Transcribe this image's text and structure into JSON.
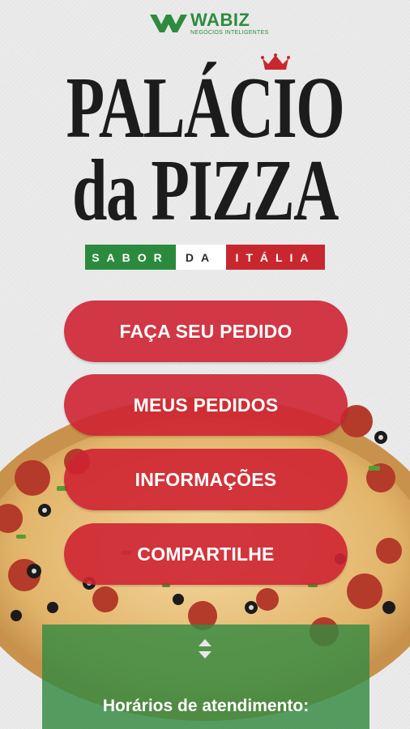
{
  "brand": {
    "name": "WABIZ",
    "tagline": "NEGÓCIOS INTELIGENTES",
    "color": "#2e8b3e"
  },
  "logo": {
    "line1": "PALÁCIO",
    "line2": "da PIZZA",
    "stripe": {
      "green": "SABOR",
      "white": "DA",
      "red": "ITÁLIA"
    },
    "colors": {
      "green": "#2c8a3f",
      "white": "#ffffff",
      "red": "#c8272f"
    }
  },
  "menu": {
    "order": "FAÇA SEU PEDIDO",
    "my_orders": "MEUS PEDIDOS",
    "info": "INFORMAÇÕES",
    "share": "COMPARTILHE",
    "button_color": "#ce2332"
  },
  "panel": {
    "title": "Horários de atendimento:",
    "toggle_icon": "up-down-arrows-icon",
    "color": "#348a42"
  }
}
